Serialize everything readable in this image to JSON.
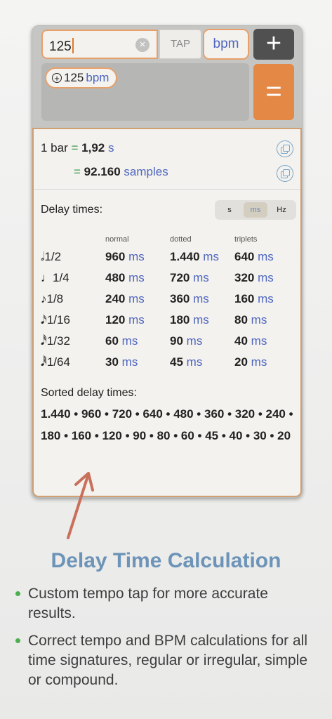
{
  "input": {
    "tempo_value": "125",
    "tap_label": "TAP",
    "unit_label": "bpm",
    "plus_label": "+",
    "equals_label": "="
  },
  "stack": {
    "chip_value": "125",
    "chip_unit": "bpm"
  },
  "result": {
    "bar_label": "1 bar",
    "equals": "=",
    "bar_seconds": "1,92",
    "bar_seconds_unit": "s",
    "bar_samples": "92.160",
    "bar_samples_unit": "samples"
  },
  "delay": {
    "title": "Delay times:",
    "units": [
      "s",
      "ms",
      "Hz"
    ],
    "active_unit": "ms",
    "columns": [
      "normal",
      "dotted",
      "triplets"
    ],
    "unit": "ms",
    "rows": [
      {
        "note": "𝅗𝅥1/2",
        "normal": "960",
        "dotted": "1.440",
        "triplets": "640"
      },
      {
        "note": "♩1/4",
        "normal": "480",
        "dotted": "720",
        "triplets": "320"
      },
      {
        "note": "♪1/8",
        "normal": "240",
        "dotted": "360",
        "triplets": "160"
      },
      {
        "note": "𝅘𝅥𝅯1/16",
        "normal": "120",
        "dotted": "180",
        "triplets": "80"
      },
      {
        "note": "𝅘𝅥𝅰1/32",
        "normal": "60",
        "dotted": "90",
        "triplets": "40"
      },
      {
        "note": "𝅘𝅥𝅱1/64",
        "normal": "30",
        "dotted": "45",
        "triplets": "20"
      }
    ]
  },
  "sorted": {
    "title": "Sorted delay times:",
    "values": "1.440 • 960 • 720 • 640 • 480 • 360 • 320 • 240 • 180 • 160 • 120 • 90 • 80 • 60 • 45 • 40 • 30 • 20"
  },
  "promo": {
    "headline": "Delay Time Calculation",
    "features": [
      "Custom tempo tap for more accurate results.",
      "Correct tempo and BPM calculations for all time signatures, regular or irregular, simple or compound."
    ]
  },
  "colors": {
    "accent_orange": "#e48845",
    "unit_blue": "#4e66bf",
    "headline_blue": "#6d94b8",
    "bullet_green": "#4caf50"
  }
}
